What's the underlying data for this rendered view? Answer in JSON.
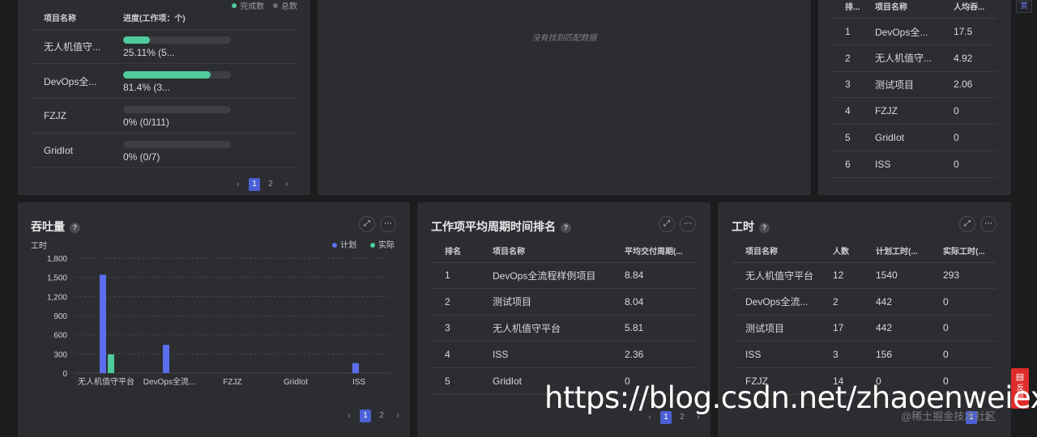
{
  "progress_panel": {
    "legend_done": "完成数",
    "legend_total": "总数",
    "col_name": "项目名称",
    "col_progress": "进度(工作项：个)",
    "rows": [
      {
        "name": "无人机值守...",
        "text": "25.11%  (5...",
        "fraction": 0.2511
      },
      {
        "name": "DevOps全...",
        "text": "81.4%  (3...",
        "fraction": 0.814
      },
      {
        "name": "FZJZ",
        "text": "0%  (0/111)",
        "fraction": 0
      },
      {
        "name": "GridIot",
        "text": "0%  (0/7)",
        "fraction": 0
      }
    ],
    "pager": {
      "prev": "‹",
      "pages": [
        "1",
        "2"
      ],
      "active": "1",
      "next": "›"
    }
  },
  "empty_panel": {
    "message": "没有找到匹配数据"
  },
  "throughput_rank_panel": {
    "col_rank": "排...",
    "col_name": "项目名称",
    "col_value": "人均吞...",
    "rows": [
      {
        "rank": "1",
        "name": "DevOps全...",
        "value": "17.5"
      },
      {
        "rank": "2",
        "name": "无人机值守...",
        "value": "4.92"
      },
      {
        "rank": "3",
        "name": "测试项目",
        "value": "2.06"
      },
      {
        "rank": "4",
        "name": "FZJZ",
        "value": "0"
      },
      {
        "rank": "5",
        "name": "GridIot",
        "value": "0"
      },
      {
        "rank": "6",
        "name": "ISS",
        "value": "0"
      }
    ]
  },
  "throughput_panel": {
    "title": "吞吐量",
    "help": "?",
    "expand_icon": "expand-icon",
    "more_icon": "more-icon",
    "pager": {
      "prev": "‹",
      "pages": [
        "1",
        "2"
      ],
      "active": "1",
      "next": "›"
    }
  },
  "chart_data": {
    "type": "bar",
    "ylabel": "工时",
    "categories": [
      "无人机值守平台",
      "DevOps全流...",
      "FZJZ",
      "GridIot",
      "ISS"
    ],
    "series": [
      {
        "name": "计划",
        "color": "#5b6ef0",
        "values": [
          1540,
          442,
          0,
          0,
          156
        ]
      },
      {
        "name": "实际",
        "color": "#4ecb9c",
        "values": [
          293,
          0,
          0,
          0,
          0
        ]
      }
    ],
    "yticks": [
      "0",
      "300",
      "600",
      "900",
      "1,200",
      "1,500",
      "1,800"
    ],
    "ylim": [
      0,
      1800
    ],
    "grid": true,
    "legend_position": "top-right"
  },
  "cycle_panel": {
    "title": "工作项平均周期时间排名",
    "help": "?",
    "col_rank": "排名",
    "col_name": "项目名称",
    "col_value": "平均交付周期(...",
    "rows": [
      {
        "rank": "1",
        "name": "DevOps全流程样例项目",
        "value": "8.84"
      },
      {
        "rank": "2",
        "name": "测试项目",
        "value": "8.04"
      },
      {
        "rank": "3",
        "name": "无人机值守平台",
        "value": "5.81"
      },
      {
        "rank": "4",
        "name": "ISS",
        "value": "2.36"
      },
      {
        "rank": "5",
        "name": "GridIot",
        "value": "0"
      }
    ],
    "pager": {
      "prev": "‹",
      "pages": [
        "1",
        "2"
      ],
      "active": "1",
      "next": "›"
    }
  },
  "hours_panel": {
    "title": "工时",
    "help": "?",
    "col_name": "项目名称",
    "col_people": "人数",
    "col_plan": "计划工时(...",
    "col_actual": "实际工时(...",
    "rows": [
      {
        "name": "无人机值守平台",
        "people": "12",
        "plan": "1540",
        "actual": "293"
      },
      {
        "name": "DevOps全流...",
        "people": "2",
        "plan": "442",
        "actual": "0"
      },
      {
        "name": "测试项目",
        "people": "17",
        "plan": "442",
        "actual": "0"
      },
      {
        "name": "ISS",
        "people": "3",
        "plan": "156",
        "actual": "0"
      },
      {
        "name": "FZJZ",
        "people": "14",
        "plan": "0",
        "actual": "0"
      }
    ],
    "pager": {
      "pages": [
        "1",
        "2"
      ],
      "active": "1",
      "next": "›"
    }
  },
  "side_tab": {
    "label": "赏"
  },
  "feedback": {
    "label": "反馈"
  },
  "watermark": {
    "url": "https://blog.csdn.net/zhaoenweiex",
    "credit": "@稀土掘金技术社区"
  },
  "colors": {
    "accent": "#5b6ef0",
    "green": "#4ecb9c",
    "panel": "#2c2d30",
    "background": "#1b1c1e"
  }
}
